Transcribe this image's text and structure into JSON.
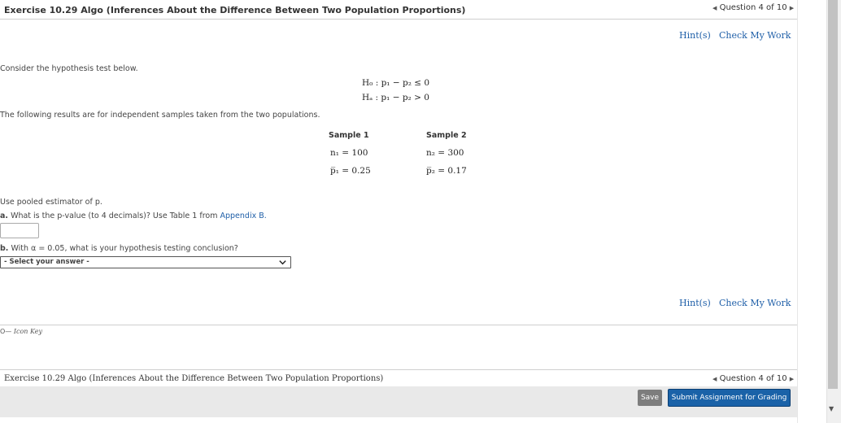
{
  "header": {
    "title": "Exercise 10.29 Algo (Inferences About the Difference Between Two Population Proportions)",
    "question_nav": "Question 4 of 10"
  },
  "links": {
    "hint": "Hint(s)",
    "check": "Check My Work"
  },
  "intro": "Consider the hypothesis test below.",
  "hypotheses": {
    "h0": "H₀ : p₁ − p₂ ≤ 0",
    "ha": "Hₐ : p₁ − p₂ > 0"
  },
  "results_text": "The following results are for independent samples taken from the two populations.",
  "table": {
    "sample1_label": "Sample 1",
    "sample2_label": "Sample 2",
    "n1": "n₁ = 100",
    "n2": "n₂ = 300",
    "p1": "p̅₁ = 0.25",
    "p2": "p̅₂ = 0.17"
  },
  "pooled_text": "Use pooled estimator of p.",
  "part_a": {
    "label": "a.",
    "text": "What is the p-value (to 4 decimals)? Use Table 1 from",
    "link": "Appendix B.",
    "answer_value": ""
  },
  "part_b": {
    "label": "b.",
    "text": "With α = 0.05, what is your hypothesis testing conclusion?",
    "select_value": "- Select your answer -"
  },
  "icon_key": "Icon Key",
  "footer": {
    "title": "Exercise 10.29 Algo (Inferences About the Difference Between Two Population Proportions)",
    "question_nav": "Question 4 of 10",
    "save_label": "Save",
    "submit_label": "Submit Assignment for Grading"
  },
  "colors": {
    "link": "#1f5fa8",
    "submit_bg": "#1a62a8",
    "save_bg": "#7d7d7d",
    "footer_bg": "#e9e9e9"
  }
}
